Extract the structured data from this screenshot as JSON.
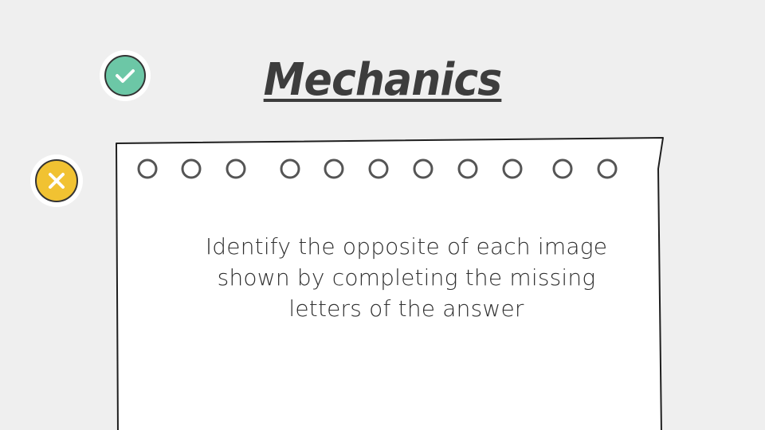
{
  "slide": {
    "title": "Mechanics",
    "instruction": "Identify the opposite of each image shown by completing the missing letters of the answer"
  },
  "icons": {
    "check": "check-icon",
    "cross": "close-icon"
  },
  "colors": {
    "background": "#efefef",
    "check_badge": "#6cc7a6",
    "cross_badge": "#f1c232",
    "outline": "#333333",
    "paper": "#ffffff"
  }
}
